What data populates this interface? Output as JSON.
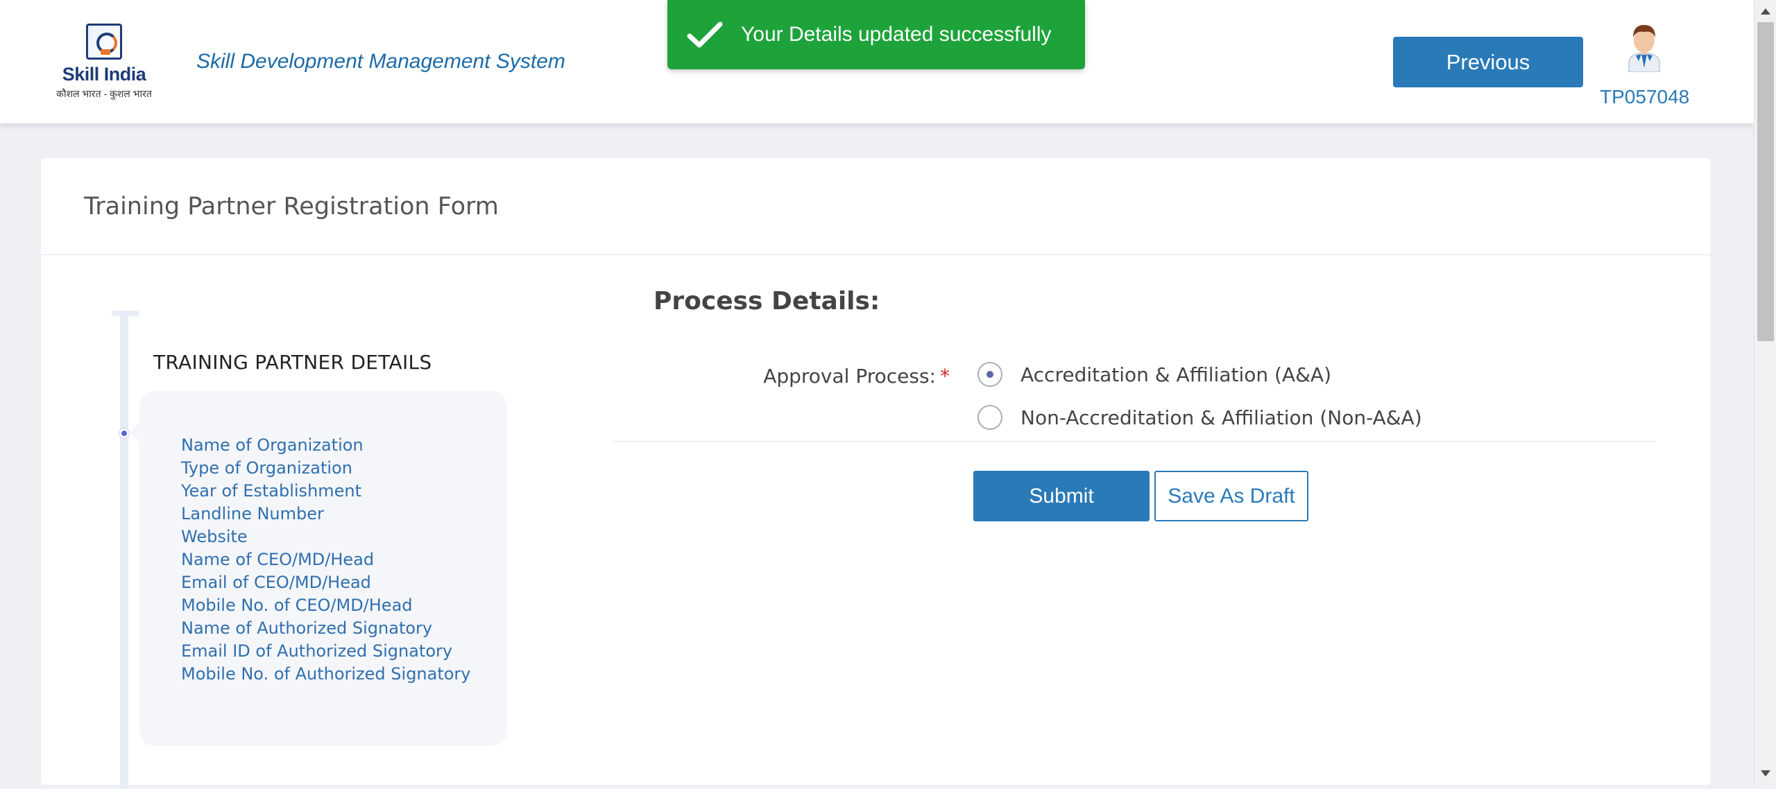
{
  "header": {
    "logo": {
      "title": "Skill India",
      "tagline": "कौशल भारत - कुशल भारत"
    },
    "system_title": "Skill Development Management System",
    "toast": {
      "message": "Your Details updated successfully",
      "icon": "checkmark-icon",
      "color": "#1ea33b"
    },
    "previous_label": "Previous",
    "user_id": "TP057048",
    "avatar_icon": "user-avatar-icon"
  },
  "form": {
    "title": "Training Partner Registration Form"
  },
  "sidebar": {
    "section_heading": "TRAINING PARTNER DETAILS",
    "items": [
      "Name of Organization",
      "Type of Organization",
      "Year of Establishment",
      "Landline Number",
      "Website",
      "Name of CEO/MD/Head",
      "Email of CEO/MD/Head",
      "Mobile No. of CEO/MD/Head",
      "Name of Authorized Signatory",
      "Email ID of Authorized Signatory",
      "Mobile No. of Authorized Signatory"
    ]
  },
  "process": {
    "heading": "Process Details:",
    "approval_label": "Approval Process:",
    "required_marker": "*",
    "options": [
      {
        "label": "Accreditation & Affiliation (A&A)",
        "selected": true
      },
      {
        "label": "Non-Accreditation & Affiliation (Non-A&A)",
        "selected": false
      }
    ],
    "submit_label": "Submit",
    "save_draft_label": "Save As Draft"
  },
  "colors": {
    "primary": "#2a7ab8",
    "success": "#1ea33b",
    "link_text": "#2f6fae",
    "required": "#d62828"
  }
}
